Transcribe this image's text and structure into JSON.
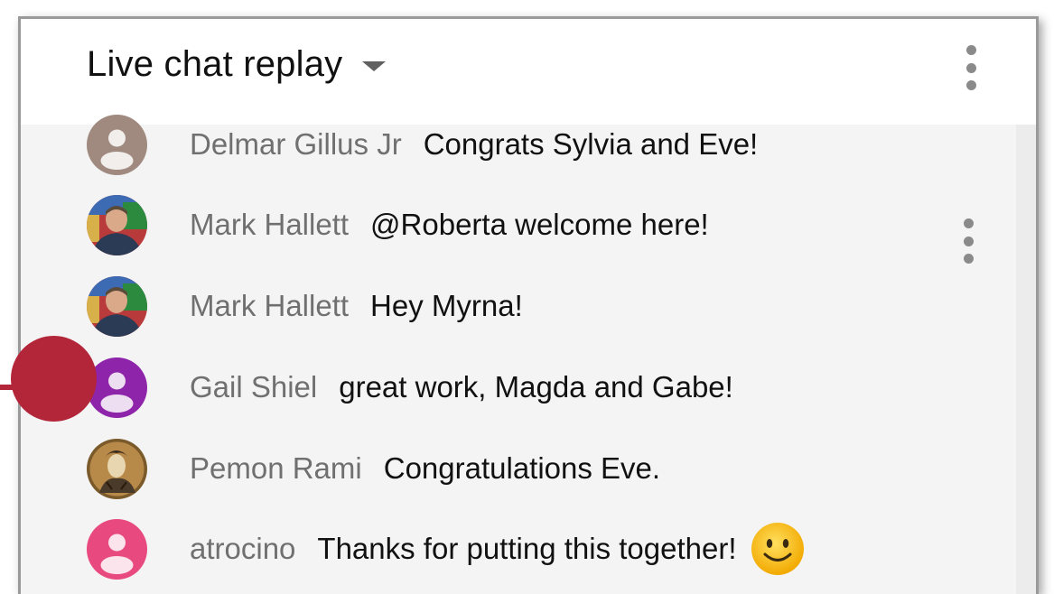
{
  "header": {
    "title": "Live chat replay"
  },
  "messages": [
    {
      "author": "Delmar Gillus Jr",
      "text": "Congrats Sylvia and Eve!",
      "avatar": "default-avatar-brown",
      "avatar_color": "#a08a80"
    },
    {
      "author": "Mark Hallett",
      "text": "@Roberta welcome here!",
      "avatar": "photo-avatar-man"
    },
    {
      "author": "Mark Hallett",
      "text": "Hey Myrna!",
      "avatar": "photo-avatar-man"
    },
    {
      "author": "Gail Shiel",
      "text": "great work, Magda and Gabe!",
      "avatar": "default-avatar-purple",
      "avatar_color": "#8e24aa"
    },
    {
      "author": "Pemon Rami",
      "text": "Congratulations Eve.",
      "avatar": "illustrated-avatar"
    },
    {
      "author": "atrocino",
      "text": "Thanks for putting this together!",
      "avatar": "default-avatar-pink",
      "avatar_color": "#e84a7f",
      "emoji": "slightly-smiling-face"
    }
  ],
  "colors": {
    "marker": "#b3263a",
    "author_text": "#707070",
    "message_text": "#111111"
  }
}
